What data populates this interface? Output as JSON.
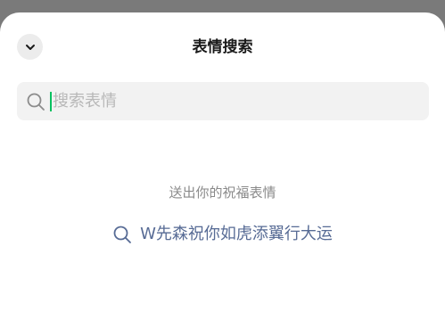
{
  "header": {
    "title": "表情搜索",
    "collapse_icon": "chevron-down-icon"
  },
  "search": {
    "placeholder": "搜索表情",
    "value": "",
    "icon": "search-icon"
  },
  "empty_state": {
    "hint": "送出你的祝福表情"
  },
  "suggestion": {
    "icon": "search-icon",
    "text": "W先森祝你如虎添翼行大运"
  },
  "colors": {
    "cursor": "#07c160",
    "suggestion_text": "#576b95",
    "hint_text": "#8a8a8a"
  }
}
